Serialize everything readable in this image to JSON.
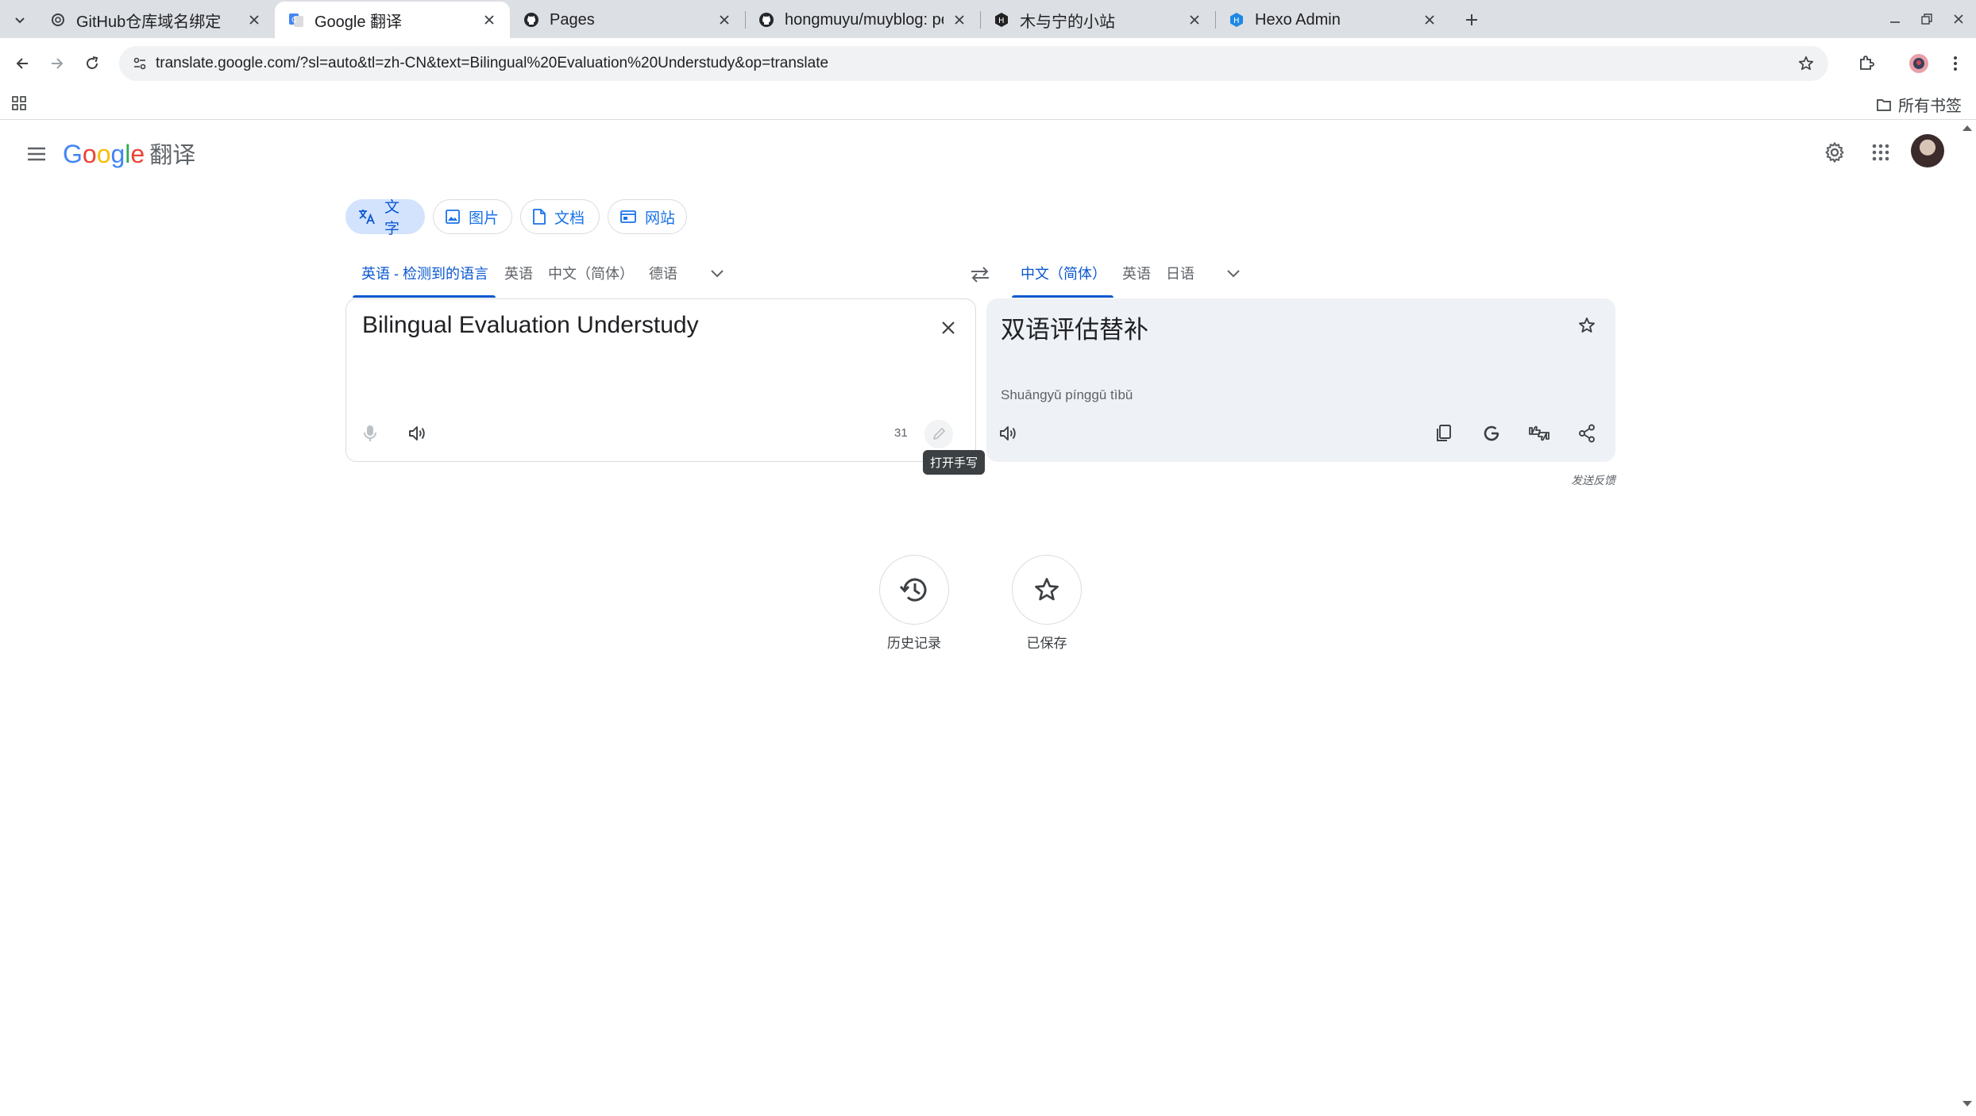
{
  "browser": {
    "tabs": [
      {
        "title": "GitHub仓库域名绑定",
        "active": false,
        "favicon": "chatgpt-icon"
      },
      {
        "title": "Google 翻译",
        "active": true,
        "favicon": "google-translate-icon"
      },
      {
        "title": "Pages",
        "active": false,
        "favicon": "github-icon"
      },
      {
        "title": "hongmuyu/muyblog: pe",
        "active": false,
        "favicon": "github-icon"
      },
      {
        "title": "木与宁的小站",
        "active": false,
        "favicon": "hexo-icon"
      },
      {
        "title": "Hexo Admin",
        "active": false,
        "favicon": "hexo-admin-icon"
      }
    ],
    "url": "translate.google.com/?sl=auto&tl=zh-CN&text=Bilingual%20Evaluation%20Understudy&op=translate",
    "bookmarks": {
      "all_bookmarks_label": "所有书签"
    }
  },
  "app": {
    "logo_text": "Google",
    "product_name": "翻译",
    "logo_colors": [
      "#4285F4",
      "#EA4335",
      "#FBBC05",
      "#4285F4",
      "#34A853",
      "#EA4335"
    ]
  },
  "modes": [
    {
      "label": "文字",
      "icon": "translate-icon",
      "active": true
    },
    {
      "label": "图片",
      "icon": "image-icon",
      "active": false
    },
    {
      "label": "文档",
      "icon": "document-icon",
      "active": false
    },
    {
      "label": "网站",
      "icon": "website-icon",
      "active": false
    }
  ],
  "source_languages": [
    "英语 - 检测到的语言",
    "英语",
    "中文（简体）",
    "德语"
  ],
  "target_languages": [
    "中文（简体）",
    "英语",
    "日语"
  ],
  "source": {
    "text": "Bilingual Evaluation Understudy",
    "char_count": "31",
    "handwriting_tooltip": "打开手写"
  },
  "target": {
    "text": "双语评估替补",
    "pinyin": "Shuāngyǔ pínggū tìbǔ"
  },
  "feedback_label": "发送反馈",
  "shortcuts": [
    {
      "label": "历史记录",
      "icon": "history-icon"
    },
    {
      "label": "已保存",
      "icon": "star-icon"
    }
  ],
  "colors": {
    "accent": "#0b57d0",
    "chip_active_bg": "#d3e3fd",
    "target_panel_bg": "#eef1f5",
    "tabstrip_bg": "#dcdfe3"
  }
}
